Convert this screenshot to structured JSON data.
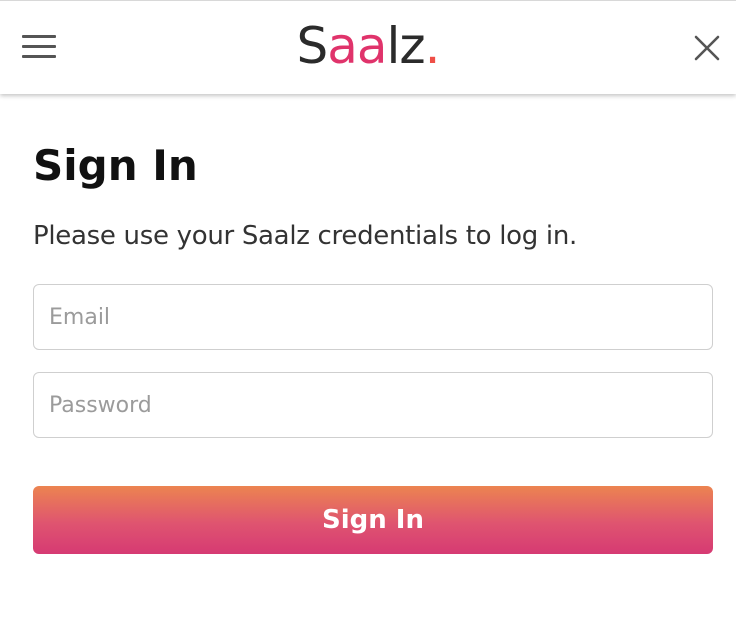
{
  "header": {
    "logo": {
      "part1": "S",
      "part2": "aa",
      "part3": "lz",
      "part4": ".",
      "colors": {
        "text": "#2b2b2b",
        "accent": "#e0336b",
        "dot": "#ef4f47"
      }
    },
    "menu_icon": "hamburger-menu-icon",
    "close_icon": "close-icon"
  },
  "main": {
    "title": "Sign In",
    "subtitle": "Please use your Saalz credentials to log in.",
    "email": {
      "placeholder": "Email",
      "value": ""
    },
    "password": {
      "placeholder": "Password",
      "value": ""
    },
    "submit_label": "Sign In",
    "button_gradient": [
      "#ec8450",
      "#d63a73"
    ]
  }
}
